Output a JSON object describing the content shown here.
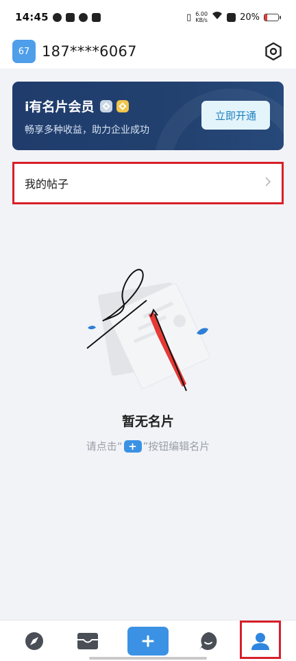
{
  "status_bar": {
    "time": "14:45",
    "speed_value": "6.00",
    "speed_unit": "KB/s",
    "battery_text": "20%",
    "battery_level": 0.2
  },
  "header": {
    "avatar_text": "67",
    "phone": "187****6067",
    "settings_icon": "gear-hexagon-icon"
  },
  "member_card": {
    "title": "i有名片会员",
    "subtitle": "畅享多种收益，助力企业成功",
    "button_label": "立即开通"
  },
  "posts": {
    "label": "我的帖子"
  },
  "empty_state": {
    "title": "暂无名片",
    "hint_before": "请点击“",
    "hint_plus": "+",
    "hint_after": "”按钮编辑名片"
  },
  "bottom_nav": {
    "items": [
      {
        "icon": "compass-icon"
      },
      {
        "icon": "inbox-icon"
      },
      {
        "icon": "plus-icon",
        "label": "+"
      },
      {
        "icon": "chat-bubble-icon"
      },
      {
        "icon": "profile-icon"
      }
    ]
  },
  "colors": {
    "accent": "#3b92e4",
    "member_bg": "#1f3c6c",
    "highlight": "#d81e28"
  }
}
